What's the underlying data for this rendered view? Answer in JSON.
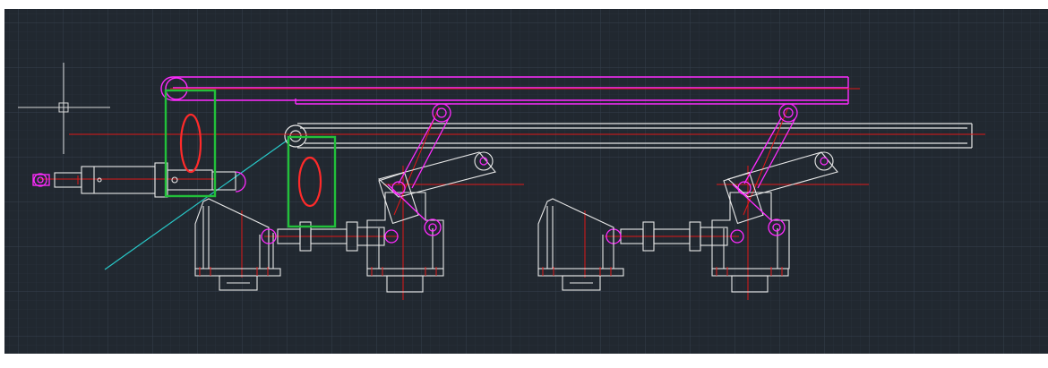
{
  "viewport": {
    "background": "#212830",
    "grid_minor": "#2b3440",
    "grid_major": "#36414e"
  },
  "colors": {
    "geometry": "#e8e8e8",
    "magenta_layer": "#ff2bff",
    "red_layer": "#e01818",
    "cyan_layer": "#28c8c8",
    "highlight_box": "#22c03a",
    "highlight_ellipse": "#ff2a2a"
  },
  "icons": {
    "crosshair": "crosshair-cursor-icon"
  }
}
